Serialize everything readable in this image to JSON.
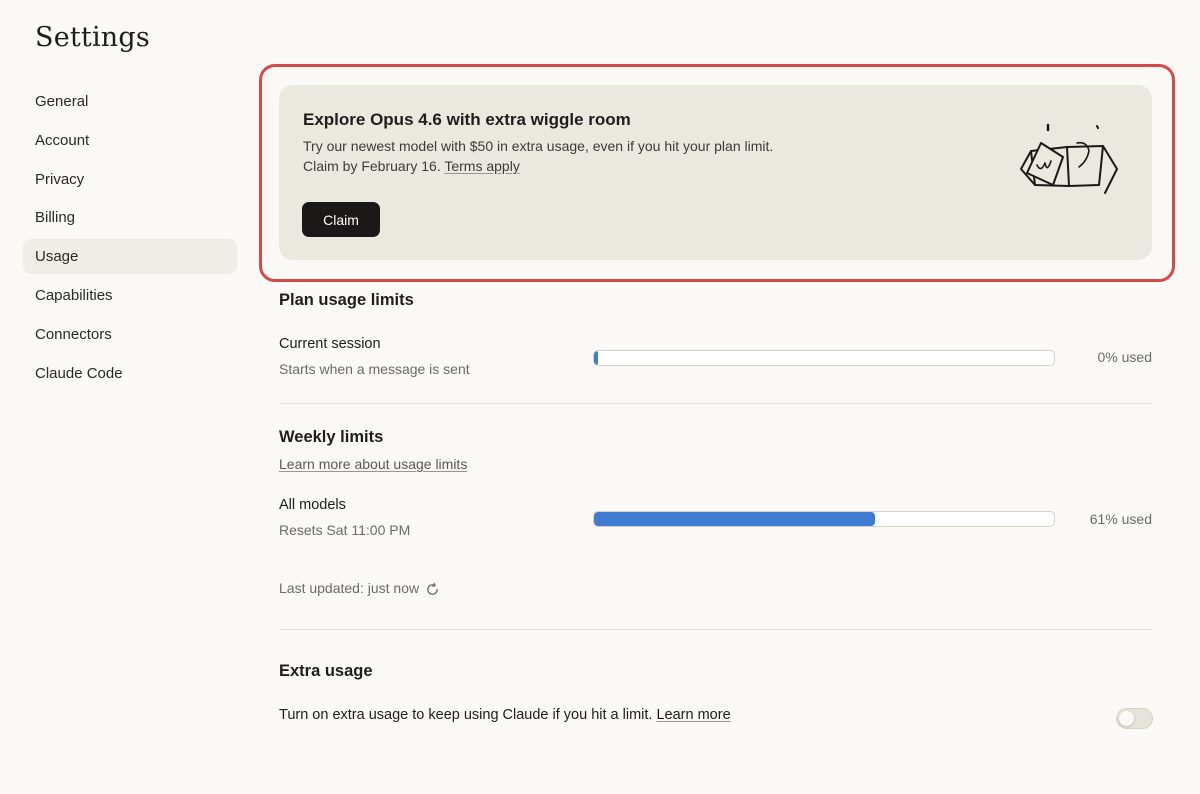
{
  "page_title": "Settings",
  "sidebar": {
    "items": [
      {
        "label": "General"
      },
      {
        "label": "Account"
      },
      {
        "label": "Privacy"
      },
      {
        "label": "Billing"
      },
      {
        "label": "Usage",
        "active": true
      },
      {
        "label": "Capabilities"
      },
      {
        "label": "Connectors"
      },
      {
        "label": "Claude Code"
      }
    ]
  },
  "promo": {
    "title": "Explore Opus 4.6 with extra wiggle room",
    "line1": "Try our newest model with $50 in extra usage, even if you hit your plan limit.",
    "line2_prefix": "Claim by February 16. ",
    "terms_link": "Terms apply",
    "claim_button": "Claim",
    "illustration": "gift-box-illustration",
    "highlight_color": "#d94848"
  },
  "plan_usage": {
    "title": "Plan usage limits",
    "current_session": {
      "label": "Current session",
      "sub": "Starts when a message is sent",
      "progress_percent": 0,
      "value_text": "0% used"
    }
  },
  "weekly": {
    "title": "Weekly limits",
    "learn_more": "Learn more about usage limits",
    "all_models": {
      "label": "All models",
      "sub": "Resets Sat 11:00 PM",
      "progress_percent": 61,
      "value_text": "61% used"
    },
    "last_updated": "Last updated: just now",
    "refresh_icon": "refresh-icon"
  },
  "extra_usage": {
    "title": "Extra usage",
    "text": "Turn on extra usage to keep using Claude if you hit a limit. ",
    "learn_more": "Learn more",
    "toggle_on": false
  },
  "colors": {
    "accent_progress": "#3f7bd1",
    "background": "#faf9f5",
    "promo_background": "#ebe8df"
  }
}
